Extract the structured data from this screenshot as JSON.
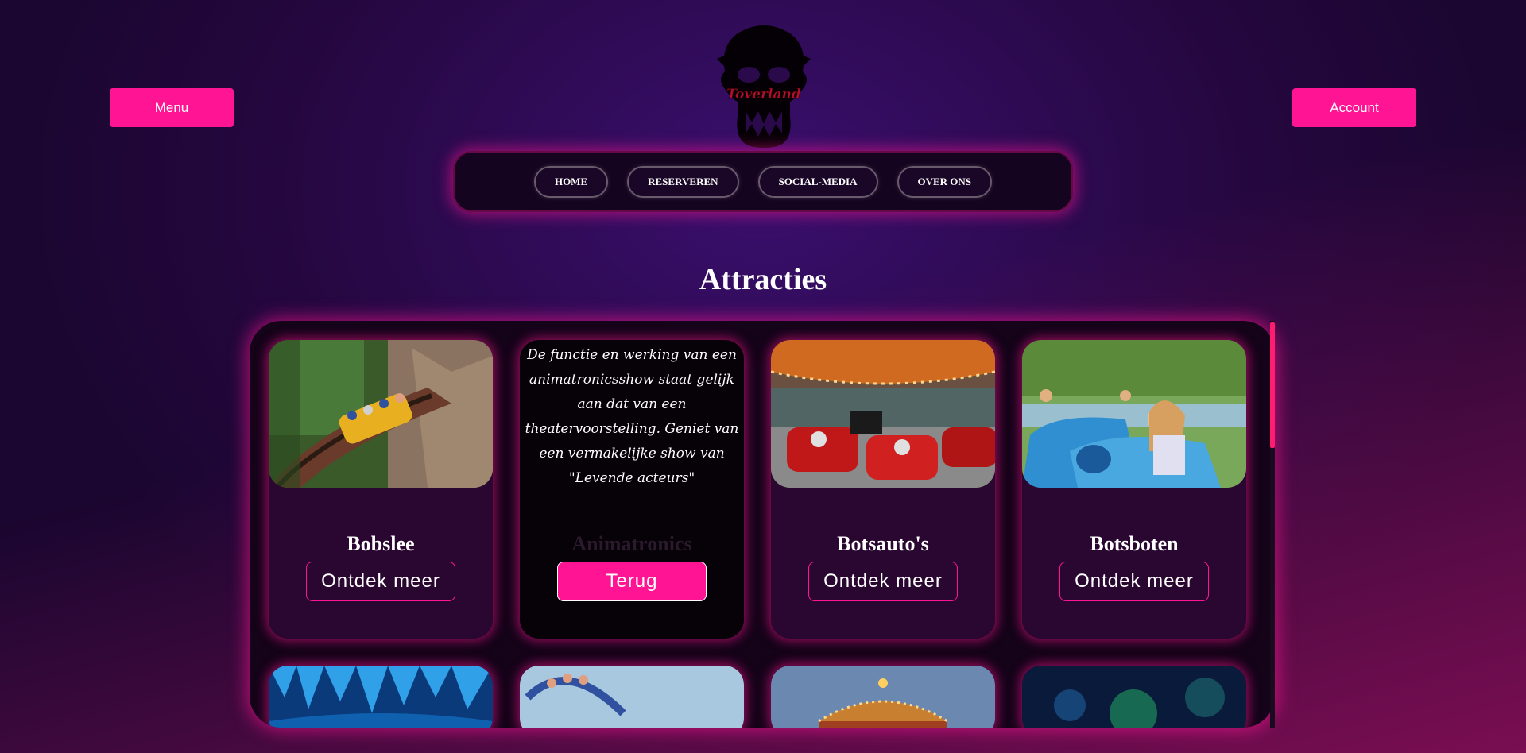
{
  "header": {
    "menu_label": "Menu",
    "account_label": "Account",
    "logo_text": "Toverland"
  },
  "nav": {
    "items": [
      {
        "label": "HOME"
      },
      {
        "label": "RESERVEREN"
      },
      {
        "label": "SOCIAL-MEDIA"
      },
      {
        "label": "OVER ONS"
      }
    ]
  },
  "main": {
    "title": "Attracties",
    "cards": [
      {
        "title": "Bobslee",
        "button": "Ontdek meer"
      },
      {
        "title": "Animatronics",
        "button": "Terug",
        "description": "De functie en werking van een animatronicsshow staat gelijk aan dat van een theatervoorstelling. Geniet van een vermakelijke show van \"Levende acteurs\""
      },
      {
        "title": "Botsauto's",
        "button": "Ontdek meer"
      },
      {
        "title": "Botsboten",
        "button": "Ontdek meer"
      }
    ]
  },
  "colors": {
    "accent": "#ff1493",
    "panel": "#140319",
    "card": "#2a0730"
  }
}
